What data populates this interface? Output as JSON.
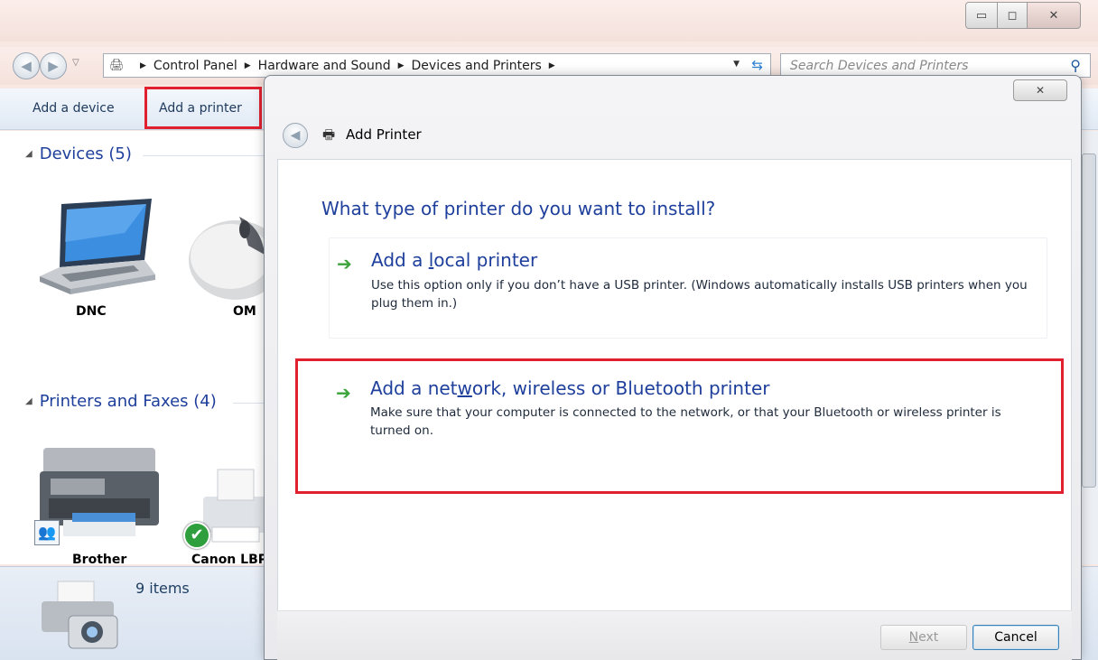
{
  "window": {
    "min_symbol": "▭",
    "max_symbol": "◻",
    "close_symbol": "✕"
  },
  "address": {
    "crumbs": [
      "Control Panel",
      "Hardware and Sound",
      "Devices and Printers"
    ]
  },
  "search": {
    "placeholder": "Search Devices and Printers"
  },
  "toolbar": {
    "add_device": "Add a device",
    "add_printer": "Add a printer"
  },
  "groups": {
    "devices": {
      "label": "Devices (5)",
      "items": [
        "DNC",
        "OM"
      ]
    },
    "printers": {
      "label": "Printers and Faxes (4)",
      "items": [
        "Brother",
        "Canon LBP"
      ]
    }
  },
  "status": {
    "items": "9 items"
  },
  "dialog": {
    "title": "Add Printer",
    "question": "What type of printer do you want to install?",
    "options": [
      {
        "title_pre": "Add a ",
        "title_u": "l",
        "title_post": "ocal printer",
        "desc": "Use this option only if you don’t have a USB printer. (Windows automatically installs USB printers when you plug them in.)"
      },
      {
        "title_pre": "Add a net",
        "title_u": "w",
        "title_post": "ork, wireless or Bluetooth printer",
        "desc": "Make sure that your computer is connected to the network, or that your Bluetooth or wireless printer is turned on."
      }
    ],
    "next_u": "N",
    "next_rest": "ext",
    "cancel": "Cancel"
  },
  "colors": {
    "highlight": "#e0202f",
    "link_blue": "#1e3f9b",
    "arrow_green": "#3aa33a"
  }
}
